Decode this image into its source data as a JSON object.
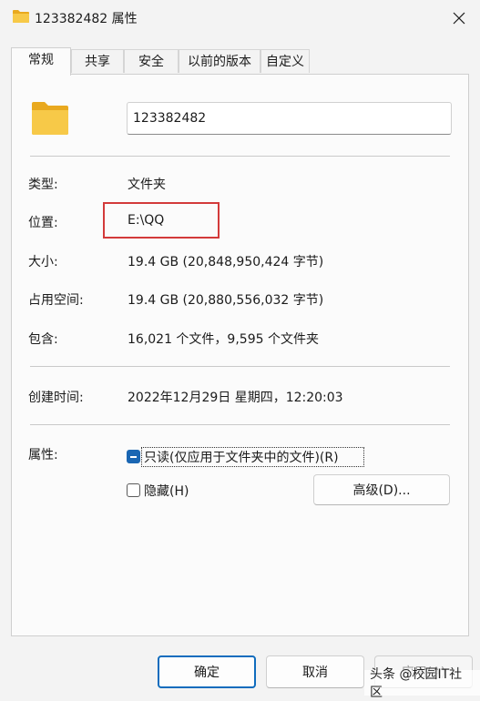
{
  "window": {
    "title": "123382482 属性",
    "close_icon": "close-icon"
  },
  "tabs": [
    {
      "label": "常规",
      "active": true
    },
    {
      "label": "共享",
      "active": false
    },
    {
      "label": "安全",
      "active": false
    },
    {
      "label": "以前的版本",
      "active": false
    },
    {
      "label": "自定义",
      "active": false
    }
  ],
  "general": {
    "folder_name": "123382482",
    "type_label": "类型:",
    "type_value": "文件夹",
    "location_label": "位置:",
    "location_value": "E:\\QQ",
    "size_label": "大小:",
    "size_value": "19.4 GB (20,848,950,424 字节)",
    "disk_size_label": "占用空间:",
    "disk_size_value": "19.4 GB (20,880,556,032 字节)",
    "contains_label": "包含:",
    "contains_value": "16,021 个文件，9,595 个文件夹",
    "created_label": "创建时间:",
    "created_value": "2022年12月29日 星期四，12:20:03",
    "attributes_label": "属性:",
    "readonly_label": "只读(仅应用于文件夹中的文件)(R)",
    "hidden_label": "隐藏(H)",
    "advanced_button": "高级(D)..."
  },
  "footer": {
    "ok_button": "确定",
    "cancel_button": "取消",
    "apply_button": "应用(A)"
  },
  "watermark": "头条 @校园IT社区",
  "colors": {
    "accent": "#0f6cbd",
    "checkbox": "#1a66b3",
    "highlight": "#d33a3a",
    "folder": "#f5c33b"
  }
}
